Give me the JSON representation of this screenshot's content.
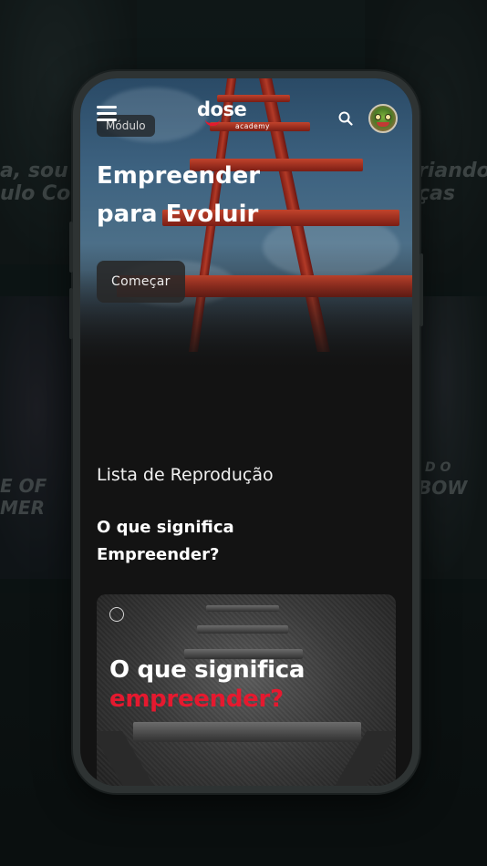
{
  "app": {
    "logo_word": "dose",
    "logo_sub": "academy"
  },
  "header": {
    "menu_icon": "menu-icon",
    "search_icon": "search-icon",
    "avatar_icon": "avatar"
  },
  "hero": {
    "module_label": "Módulo",
    "title_line1": "Empreender",
    "title_line2": "para Evoluir",
    "start_button": "Começar"
  },
  "playlist": {
    "heading": "Lista de Reprodução",
    "episode_title_line1": "O que significa",
    "episode_title_line2": "Empreender?",
    "thumbnail": {
      "line1": "O que significa",
      "line2": "empreender?"
    }
  },
  "background": {
    "left_top_text1": "a, sou",
    "left_top_text2": "ulo Cou",
    "right_top_text1": "riando",
    "right_top_text2": "ças",
    "left_mid_text1": "E OF",
    "left_mid_text2": "MER",
    "right_mid_text1": "D O",
    "right_mid_text2": "BOW"
  },
  "colors": {
    "accent": "#e5192f",
    "screen_bg": "#131313",
    "ladder": "#b23a27"
  }
}
